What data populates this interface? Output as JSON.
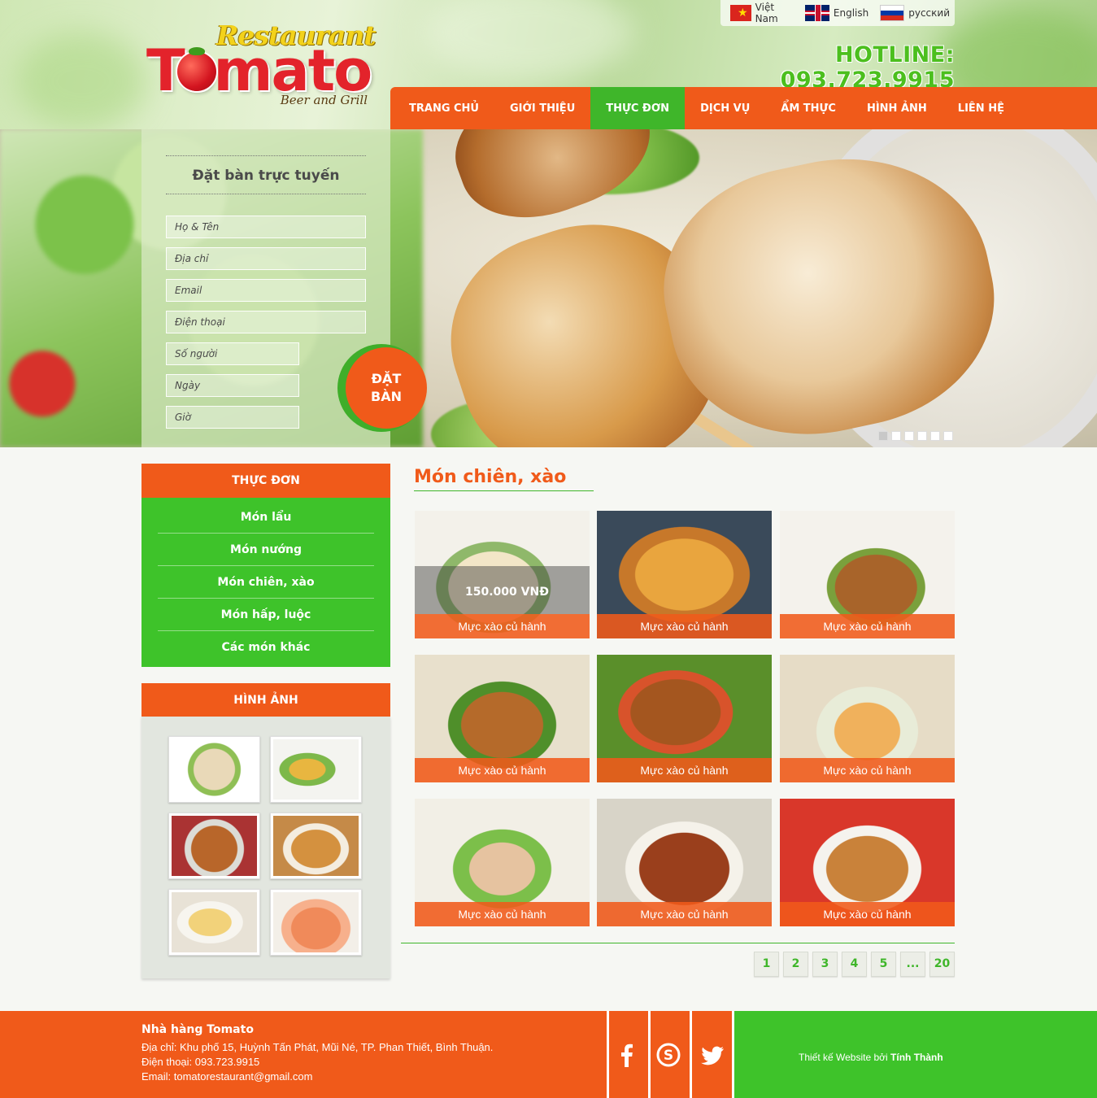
{
  "brand": {
    "script": "Restaurant",
    "name": "Tomato",
    "tagline": "Beer and Grill"
  },
  "languages": [
    {
      "label": "Việt Nam",
      "icon": "flag-vietnam-icon"
    },
    {
      "label": "English",
      "icon": "flag-uk-icon"
    },
    {
      "label": "русский",
      "icon": "flag-russia-icon"
    }
  ],
  "hotline": "HOTLINE: 093.723.9915",
  "nav": {
    "items": [
      "TRANG CHỦ",
      "GIỚI THIỆU",
      "THỰC ĐƠN",
      "DỊCH VỤ",
      "ẨM THỰC",
      "HÌNH ẢNH",
      "LIÊN HỆ"
    ],
    "active": "THỰC ĐƠN"
  },
  "booking": {
    "title": "Đặt bàn trực tuyến",
    "fields": {
      "name": "Họ & Tên",
      "address": "Địa chỉ",
      "email": "Email",
      "phone": "Điện thoại",
      "people": "Số người",
      "date": "Ngày",
      "time": "Giờ"
    },
    "button_line1": "ĐẶT",
    "button_line2": "BÀN"
  },
  "slider": {
    "slide_count": 6,
    "active_index": 0
  },
  "sidebar": {
    "menu_title": "THỰC ĐƠN",
    "menu_items": [
      "Món lẩu",
      "Món nướng",
      "Món chiên, xào",
      "Món hấp, luộc",
      "Các món khác"
    ],
    "gallery_title": "HÌNH ẢNH"
  },
  "main": {
    "category_title": "Món chiên, xào",
    "items": [
      {
        "caption": "Mực xào củ hành",
        "price": "150.000 VNĐ"
      },
      {
        "caption": "Mực xào củ hành"
      },
      {
        "caption": "Mực xào củ hành"
      },
      {
        "caption": "Mực xào củ hành"
      },
      {
        "caption": "Mực xào củ hành"
      },
      {
        "caption": "Mực xào củ hành"
      },
      {
        "caption": "Mực xào củ hành"
      },
      {
        "caption": "Mực xào củ hành"
      },
      {
        "caption": "Mực xào củ hành"
      }
    ],
    "pagination": [
      "1",
      "2",
      "3",
      "4",
      "5",
      "...",
      "20"
    ]
  },
  "footer": {
    "name": "Nhà hàng Tomato",
    "address": "Địa chỉ: Khu phố 15, Huỳnh Tấn Phát, Mũi Né, TP. Phan Thiết, Bình Thuận.",
    "phone": "Điện thoại: 093.723.9915",
    "email": "Email: tomatorestaurant@gmail.com",
    "social": [
      "facebook-icon",
      "skype-icon",
      "twitter-icon"
    ],
    "credit_prefix": "Thiết kế Website bởi",
    "credit_name": "Tính Thành"
  },
  "colors": {
    "orange": "#f05a1a",
    "green": "#3ec32a",
    "logo_red": "#e3232b",
    "hotline_green": "#4cbf1e"
  }
}
